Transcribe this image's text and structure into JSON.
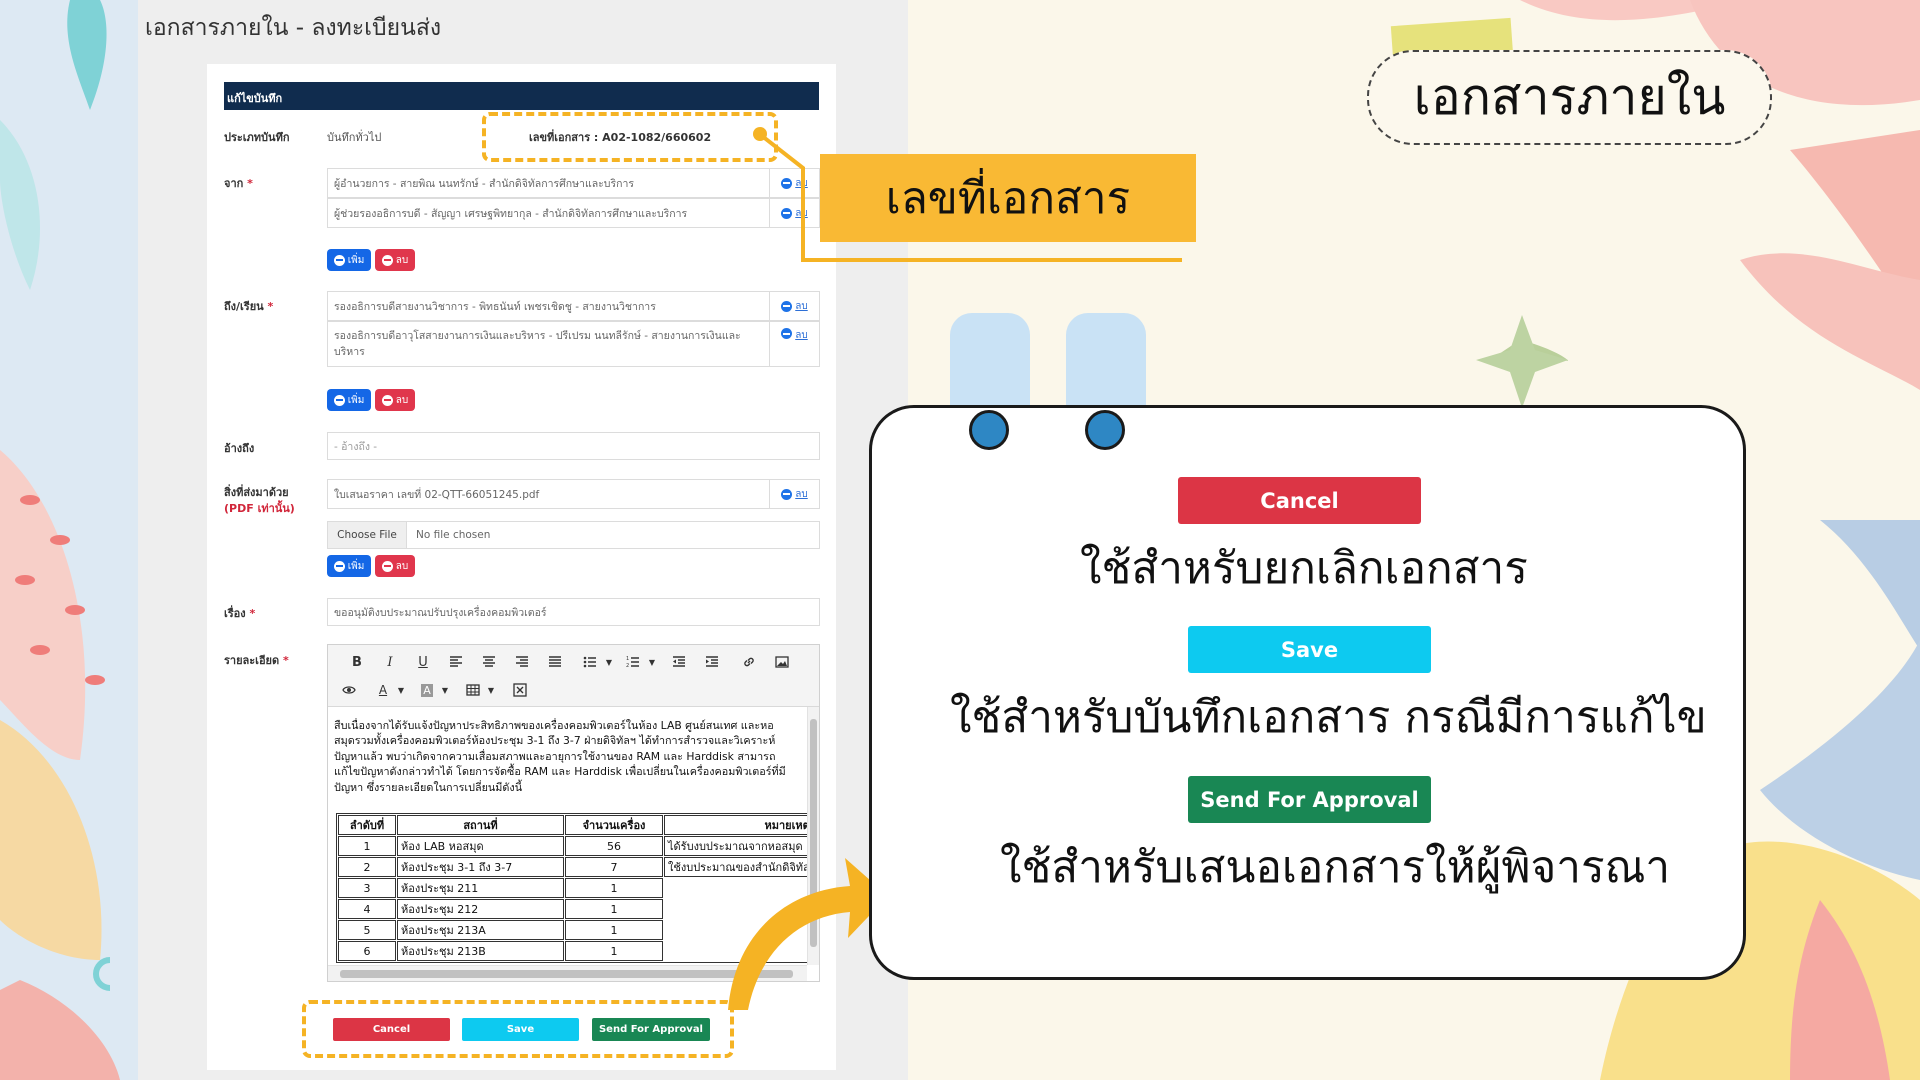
{
  "page": {
    "heading": "เอกสารภายใน - ลงทะเบียนส่ง"
  },
  "form": {
    "bar_title": "แก้ไขบันทึก",
    "type_label": "ประเภทบันทึก",
    "type_value": "บันทึกทั่วไป",
    "doc_no": "เลขที่เอกสาร : A02-1082/660602",
    "from_label": "จาก",
    "from_items": [
      "ผู้อำนวยการ - สายพิณ นนทรักษ์ - สำนักดิจิทัลการศึกษาและบริการ",
      "ผู้ช่วยรองอธิการบดี - สัญญา เศรษฐพิทยากุล - สำนักดิจิทัลการศึกษาและบริการ"
    ],
    "to_label": "ถึง/เรียน",
    "to_items": [
      "รองอธิการบดีสายงานวิชาการ - พิทธนันท์ เพชรเชิดชู - สายงานวิชาการ",
      "รองอธิการบดีอาวุโสสายงานการเงินและบริหาร - ปรีเปรม นนทลีรักษ์ - สายงานการเงินและบริหาร"
    ],
    "ref_label": "อ้างถึง",
    "ref_placeholder": "- อ้างถึง -",
    "attach_label": "สิ่งที่ส่งมาด้วย",
    "attach_sub": "(PDF เท่านั้น)",
    "attach_file": "ใบเสนอราคา เลขที่ 02-QTT-66051245.pdf",
    "choose_file": "Choose File",
    "no_file": "No file chosen",
    "subject_label": "เรื่อง",
    "subject_value": "ขออนุมัติงบประมาณปรับปรุงเครื่องคอมพิวเตอร์",
    "detail_label": "รายละเอียด",
    "required_mark": "*",
    "delete_link": "ลบ",
    "add_label": "เพิ่ม",
    "remove_label": "ลบ",
    "editor_text": "สืบเนื่องจากได้รับแจ้งปัญหาประสิทธิภาพของเครื่องคอมพิวเตอร์ในห้อง LAB ศูนย์สนเทศ และหอสมุดรวมทั้งเครื่องคอมพิวเตอร์ห้องประชุม 3-1 ถึง 3-7 ฝ่ายดิจิทัลฯ ได้ทำการสำรวจและวิเคราะห์ปัญหาแล้ว พบว่าเกิดจากความเสื่อมสภาพและอายุการใช้งานของ RAM และ Harddisk สามารถแก้ไขปัญหาดังกล่าวทำได้ โดยการจัดซื้อ RAM และ Harddisk เพื่อเปลี่ยนในเครื่องคอมพิวเตอร์ที่มีปัญหา ซึ่งรายละเอียดในการเปลี่ยนมีดังนี้",
    "table": {
      "headers": [
        "ลำดับที่",
        "สถานที่",
        "จำนวนเครื่อง",
        "หมายเหตุ"
      ],
      "rows": [
        [
          "1",
          "ห้อง LAB หอสมุด",
          "56",
          "ได้รับงบประมาณจากหอสมุด"
        ],
        [
          "2",
          "ห้องประชุม 3-1 ถึง 3-7",
          "7",
          "ใช้งบประมาณของสำนักดิจิทัล"
        ],
        [
          "3",
          "ห้องประชุม 211",
          "1",
          ""
        ],
        [
          "4",
          "ห้องประชุม 212",
          "1",
          ""
        ],
        [
          "5",
          "ห้องประชุม 213A",
          "1",
          ""
        ],
        [
          "6",
          "ห้องประชุม 213B",
          "1",
          ""
        ]
      ]
    },
    "actions": {
      "cancel": "Cancel",
      "save": "Save",
      "approve": "Send For Approval"
    }
  },
  "callout": {
    "doc_no_label": "เลขที่เอกสาร"
  },
  "slide": {
    "title": "เอกสารภายใน",
    "cancel_label": "Cancel",
    "cancel_desc": "ใช้สำหรับยกเลิกเอกสาร",
    "save_label": "Save",
    "save_desc": "ใช้สำหรับบันทึกเอกสาร กรณีมีการแก้ไข",
    "approve_label": "Send For Approval",
    "approve_desc": "ใช้สำหรับเสนอเอกสารให้ผู้พิจารณา"
  },
  "colors": {
    "cancel": "#dc3545",
    "save": "#0dcaf0",
    "approve": "#198754",
    "form_bar": "#102c4e",
    "highlight": "#f5b324"
  },
  "icons": [
    "bold-icon",
    "italic-icon",
    "underline-icon",
    "align-left-icon",
    "align-center-icon",
    "align-right-icon",
    "justify-icon",
    "bullet-list-icon",
    "number-list-icon",
    "outdent-icon",
    "indent-icon",
    "link-icon",
    "image-icon",
    "preview-icon",
    "font-color-icon",
    "background-color-icon",
    "table-icon",
    "clear-format-icon"
  ]
}
